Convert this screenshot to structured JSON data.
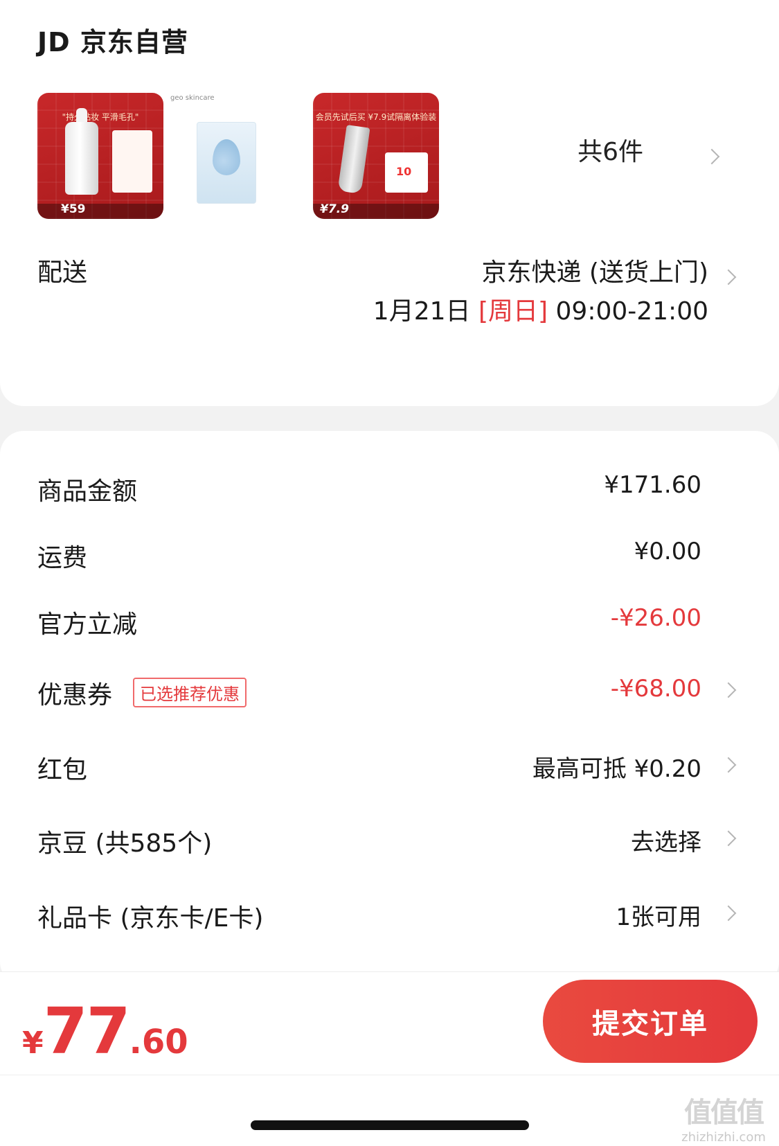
{
  "store": {
    "title": "JD 京东自营"
  },
  "products": {
    "items": [
      {
        "brand": "geo skincare",
        "headline": "\"持久贴妆 平滑毛孔\"",
        "price_label": "¥59"
      },
      {
        "brand": "geo skincare",
        "headline": "",
        "price_label": ""
      },
      {
        "brand": "geo skincare",
        "headline": "会员先试后买 ¥7.9试隔离体验装",
        "price_label": "¥7.9",
        "coupon": "10"
      }
    ],
    "count_label": "共6件"
  },
  "delivery": {
    "label": "配送",
    "method": "京东快递 (送货上门)",
    "date": "1月21日",
    "weekday": "[周日]",
    "time": "09:00-21:00"
  },
  "summary": {
    "rows": [
      {
        "label": "商品金额",
        "value": "¥171.60"
      },
      {
        "label": "运费",
        "value": "¥0.00"
      },
      {
        "label": "官方立减",
        "value": "-¥26.00"
      },
      {
        "label": "优惠券",
        "badge": "已选推荐优惠",
        "value": "-¥68.00"
      },
      {
        "label": "红包",
        "value": "最高可抵 ¥0.20"
      },
      {
        "label": "京豆 (共585个)",
        "value": "去选择"
      },
      {
        "label": "礼品卡 (京东卡/E卡)",
        "value": "1张可用"
      }
    ]
  },
  "footer": {
    "total_currency": "¥",
    "total_integer": "77",
    "total_decimal": ".60",
    "submit_label": "提交订单"
  },
  "watermark": {
    "logo": "值值值",
    "text": "zhizhizhi.com"
  },
  "colors": {
    "accent": "#e4393c",
    "background": "#f2f2f2"
  }
}
